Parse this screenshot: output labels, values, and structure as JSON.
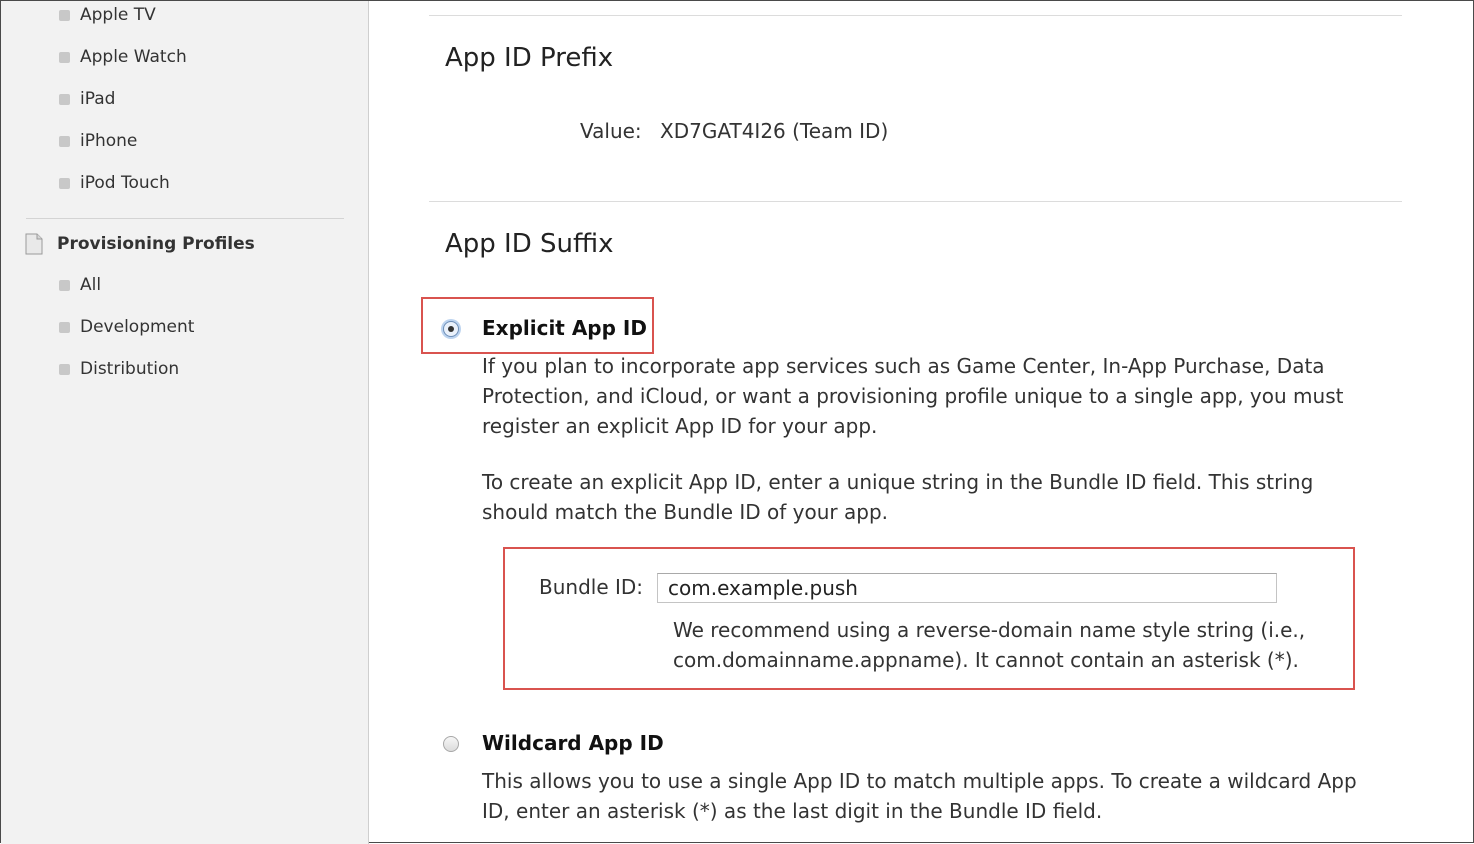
{
  "sidebar": {
    "items": [
      {
        "label": "Apple TV"
      },
      {
        "label": "Apple Watch"
      },
      {
        "label": "iPad"
      },
      {
        "label": "iPhone"
      },
      {
        "label": "iPod Touch"
      }
    ],
    "section": {
      "label": "Provisioning Profiles",
      "items": [
        {
          "label": "All"
        },
        {
          "label": "Development"
        },
        {
          "label": "Distribution"
        }
      ]
    }
  },
  "prefix": {
    "heading": "App ID Prefix",
    "value_label": "Value:",
    "value": "XD7GAT4I26 (Team ID)"
  },
  "suffix": {
    "heading": "App ID Suffix",
    "explicit": {
      "label": "Explicit App ID",
      "selected": true,
      "desc1": "If you plan to incorporate app services such as Game Center, In-App Purchase, Data Protection, and iCloud, or want a provisioning profile unique to a single app, you must register an explicit App ID for your app.",
      "desc2": "To create an explicit App ID, enter a unique string in the Bundle ID field. This string should match the Bundle ID of your app.",
      "bundle_label": "Bundle ID:",
      "bundle_value": "com.example.push",
      "bundle_hint": "We recommend using a reverse-domain name style string (i.e., com.domainname.appname). It cannot contain an asterisk (*)."
    },
    "wildcard": {
      "label": "Wildcard App ID",
      "selected": false,
      "desc": "This allows you to use a single App ID to match multiple apps. To create a wildcard App ID, enter an asterisk (*) as the last digit in the Bundle ID field."
    }
  },
  "colors": {
    "highlight_border": "#d9534f",
    "sidebar_bg": "#f2f2f2"
  }
}
